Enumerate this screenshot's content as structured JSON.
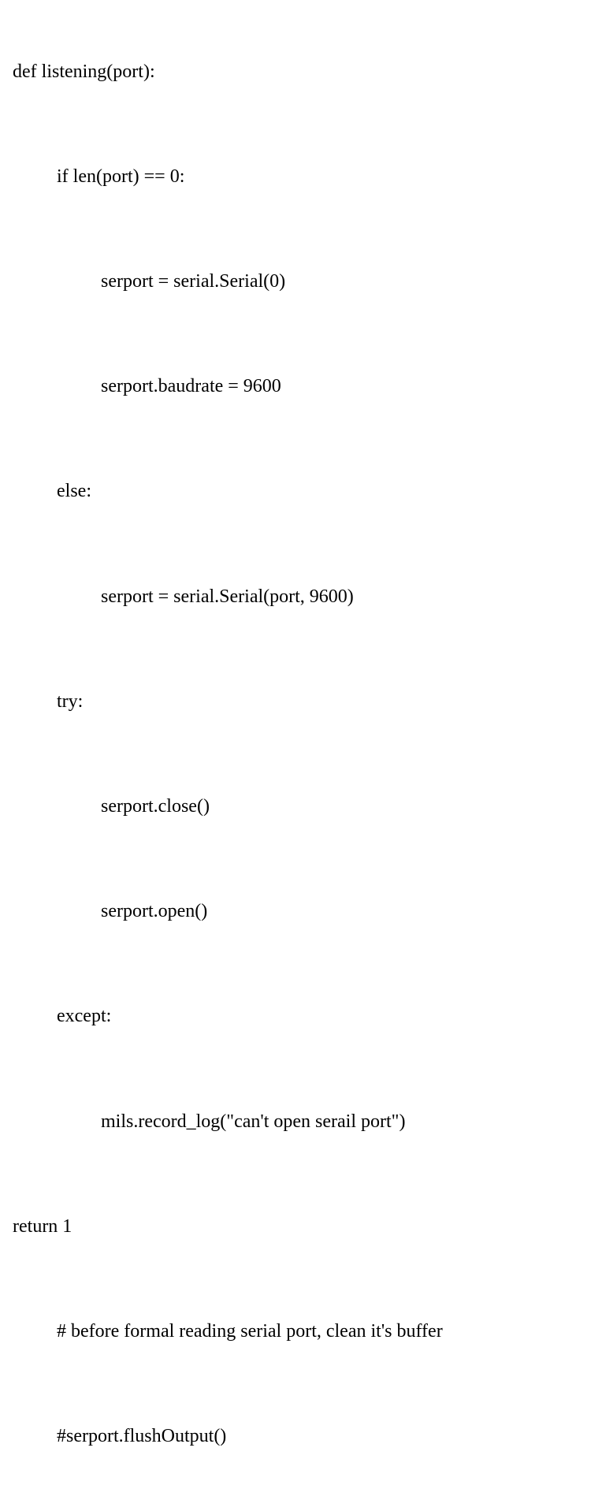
{
  "code": {
    "lines": [
      {
        "indent": 0,
        "text": "def listening(port):"
      },
      {
        "indent": 1,
        "text": "if len(port) == 0:"
      },
      {
        "indent": 2,
        "text": "serport = serial.Serial(0)"
      },
      {
        "indent": 2,
        "text": "serport.baudrate = 9600"
      },
      {
        "indent": 1,
        "text": "else:"
      },
      {
        "indent": 2,
        "text": "serport = serial.Serial(port, 9600)"
      },
      {
        "indent": 1,
        "text": "try:"
      },
      {
        "indent": 2,
        "text": "serport.close()"
      },
      {
        "indent": 2,
        "text": "serport.open()"
      },
      {
        "indent": 1,
        "text": "except:"
      },
      {
        "indent": 2,
        "text": "mils.record_log(\"can't open serail port\")"
      },
      {
        "indent": 0,
        "text": "return 1"
      },
      {
        "indent": 1,
        "text": "# before formal reading serial port, clean it's buffer"
      },
      {
        "indent": 1,
        "text": "#serport.flushOutput()"
      }
    ]
  }
}
